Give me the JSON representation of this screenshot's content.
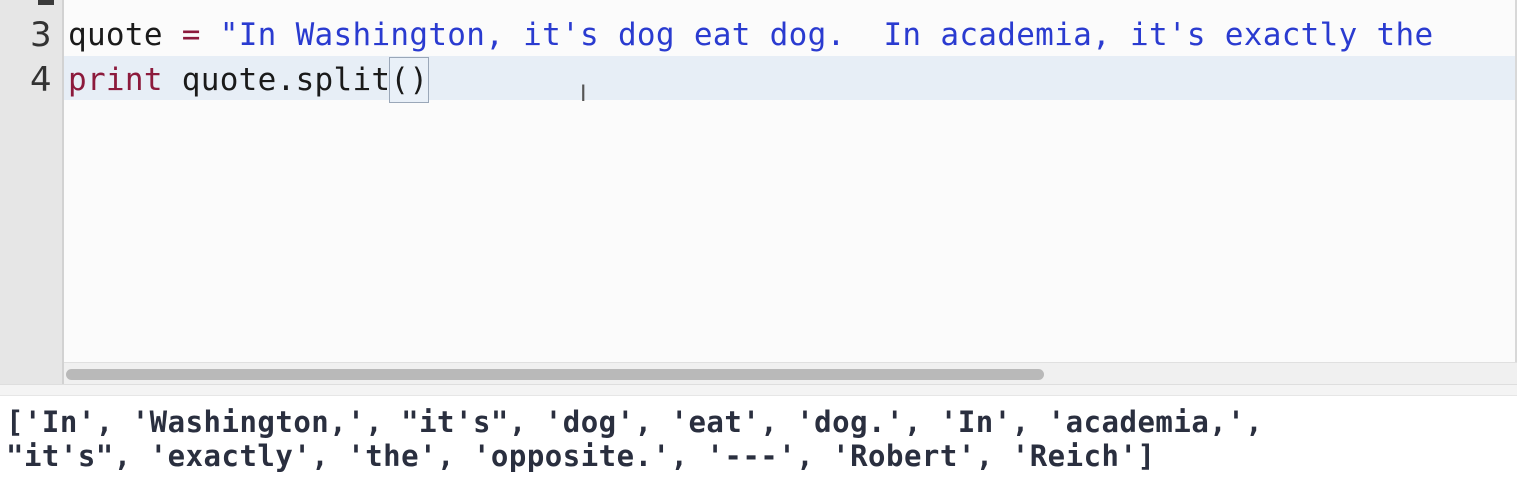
{
  "editor": {
    "lines": [
      {
        "number": "3",
        "var": "quote",
        "op": " = ",
        "string": "\"In Washington, it's dog eat dog.  In academia, it's exactly the"
      },
      {
        "number": "4",
        "keyword": "print",
        "rest": " quote.split",
        "paren": "()"
      }
    ],
    "cursor_glyph": "I"
  },
  "console": {
    "lines": [
      "['In', 'Washington,', \"it's\", 'dog', 'eat', 'dog.', 'In', 'academia,',",
      "\"it's\", 'exactly', 'the', 'opposite.', '---', 'Robert', 'Reich']"
    ]
  },
  "colors": {
    "keyword": "#8c1a3c",
    "string": "#2a3bd0",
    "current_line_bg": "#e7eef6",
    "gutter_bg": "#e6e6e6"
  }
}
